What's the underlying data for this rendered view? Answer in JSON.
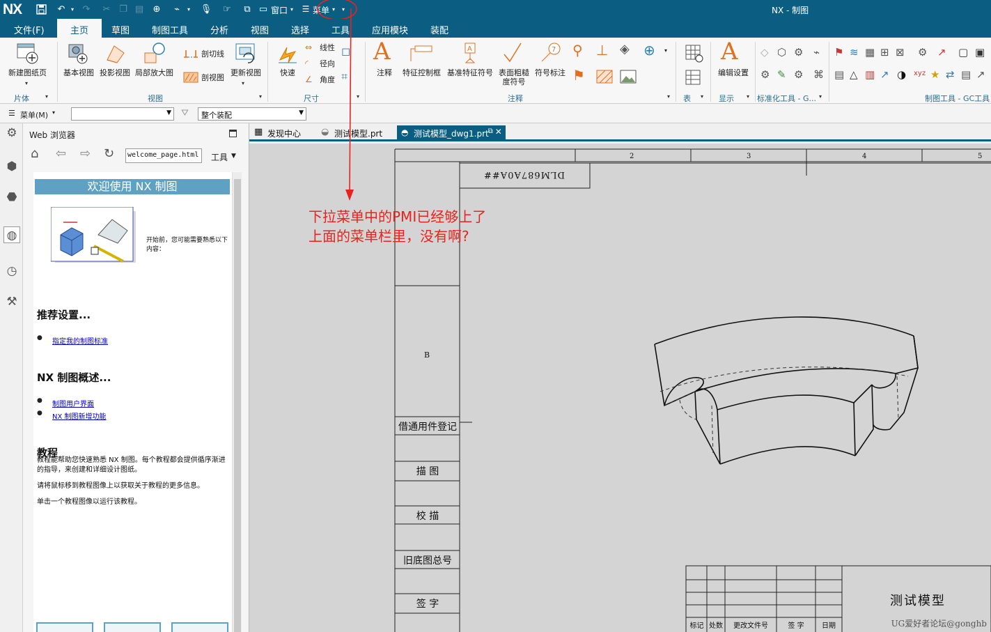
{
  "app": {
    "logo": "NX",
    "window_title": "NX - 制图",
    "window_menu": "窗口",
    "menu_label": "菜单",
    "menu_label2": "菜单(M)"
  },
  "tabs_menu": [
    "文件(F)",
    "主页",
    "草图",
    "制图工具",
    "分析",
    "视图",
    "选择",
    "工具",
    "应用模块",
    "装配"
  ],
  "ribbon": {
    "new_sheet": "新建图纸页",
    "base_view": "基本视图",
    "proj_view": "投影视图",
    "detail_view": "局部放大图",
    "section_line": "剖切线",
    "section_view": "剖视图",
    "update_view": "更新视图",
    "rapid": "快速",
    "linear": "线性",
    "radial": "径向",
    "angle": "角度",
    "note": "注释",
    "fcf": "特征控制框",
    "datum": "基准特征符号",
    "surface": "表面粗糙度符号",
    "symbol": "符号标注",
    "edit_settings": "编辑设置",
    "groups": {
      "sheet": "片体",
      "view": "视图",
      "dim": "尺寸",
      "annot": "注释",
      "table": "表",
      "display": "显示",
      "std": "标准化工具 - G...",
      "gc": "制图工具 - GC工具箱"
    }
  },
  "selbar": {
    "filter": "",
    "scope": "整个装配"
  },
  "nav": {
    "title": "Web 浏览器",
    "url": "welcome_page.html",
    "tools": "工具",
    "banner": "欢迎使用 NX 制图",
    "intro": "开始前，您可能需要熟悉以下内容：",
    "sec1": "推荐设置...",
    "link1": "指定我的制图标准",
    "sec2": "NX 制图概述...",
    "link2": "制图用户界面",
    "link3": "NX 制图新增功能",
    "sec3": "教程",
    "p1": "教程能帮助您快速熟悉 NX 制图。每个教程都会提供循序渐进的指导，来创建和详细设计图纸。",
    "p2": "请将鼠标移到教程图像上以获取关于教程的更多信息。",
    "p3": "单击一个教程图像以运行该教程。"
  },
  "doc_tabs": [
    "发现中心",
    "测试模型.prt",
    "测试模型_dwg1.prt"
  ],
  "drawing": {
    "zone_cols": [
      "2",
      "3",
      "4",
      "5"
    ],
    "zone_row": "B",
    "code_box": "DLM687A0A##",
    "side_cells": [
      "借通用件登记",
      "描 图",
      "校 描",
      "旧底图总号",
      "签 字"
    ],
    "title_cells": [
      "标记",
      "处数",
      "更改文件号",
      "签 字",
      "日期"
    ],
    "part_name": "测试模型",
    "watermark": "UG爱好者论坛@gonghb"
  },
  "annotation": {
    "line1": "下拉菜单中的PMI已经够上了",
    "line2": "上面的菜单栏里，没有啊?",
    "color": "#e8231d"
  },
  "colors": {
    "brand": "#0b5e82",
    "banner": "#5fa1c2"
  }
}
